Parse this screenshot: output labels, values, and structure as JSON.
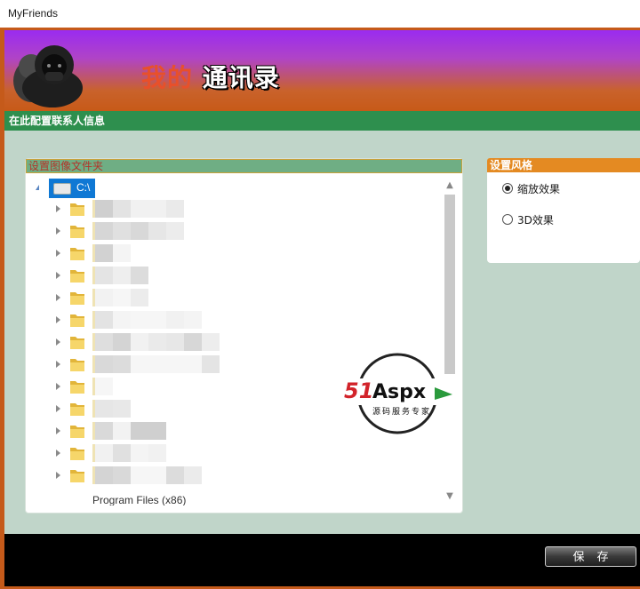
{
  "window": {
    "title": "MyFriends"
  },
  "header": {
    "logo_part1": "我的",
    "logo_part2": "通讯录"
  },
  "section": {
    "title": "在此配置联系人信息"
  },
  "folder_panel": {
    "title": "设置图像文件夹",
    "root_label": "C:\\",
    "rows": [
      {
        "pixels": [
          "#cfcfcf",
          "#e3e3e3",
          "#f1f1f1",
          "#f1f1f1",
          "#eaeaea"
        ]
      },
      {
        "pixels": [
          "#d6d6d6",
          "#e0e0e0",
          "#d8d8d8",
          "#e6e6e6",
          "#ececec"
        ]
      },
      {
        "pixels": [
          "#d2d2d2",
          "#f4f4f4"
        ]
      },
      {
        "pixels": [
          "#e4e4e4",
          "#eeeeee",
          "#dcdcdc"
        ]
      },
      {
        "pixels": [
          "#f2f2f2",
          "#f6f6f6",
          "#ececec"
        ]
      },
      {
        "pixels": [
          "#e3e3e3",
          "#f4f4f4",
          "#f6f6f6",
          "#f6f6f6",
          "#f1f1f1",
          "#f4f4f4"
        ]
      },
      {
        "pixels": [
          "#dedede",
          "#d4d4d4",
          "#f1f1f1",
          "#eaeaea",
          "#e7e7e7",
          "#d7d7d7",
          "#ededed"
        ]
      },
      {
        "pixels": [
          "#d9d9d9",
          "#dcdcdc",
          "#f6f6f6",
          "#f6f6f6",
          "#f6f6f6",
          "#f6f6f6",
          "#e4e4e4"
        ]
      },
      {
        "pixels": [
          "#f6f6f6"
        ]
      },
      {
        "pixels": [
          "#e6e6e6",
          "#e8e8e8"
        ]
      },
      {
        "pixels": [
          "#d9d9d9",
          "#f2f2f2",
          "#cfcfcf",
          "#cfcfcf"
        ]
      },
      {
        "pixels": [
          "#f1f1f1",
          "#e0e0e0",
          "#f4f4f4",
          "#f1f1f1"
        ]
      },
      {
        "pixels": [
          "#d4d4d4",
          "#d9d9d9",
          "#f6f6f6",
          "#f6f6f6",
          "#dcdcdc",
          "#ebebeb"
        ]
      }
    ],
    "last_label": "Program Files (x86)"
  },
  "watermark": {
    "brand_red": "51",
    "brand_black": "Aspx",
    "tagline": "源码服务专家"
  },
  "style_panel": {
    "title": "设置风格",
    "options": [
      {
        "label": "缩放效果",
        "selected": true
      },
      {
        "label": "3D效果",
        "selected": false
      }
    ]
  },
  "footer": {
    "save_label": "保存"
  },
  "colors": {
    "section_bar": "#2e8f4e",
    "selection": "#0f78d4",
    "style_title": "#e48a22"
  }
}
